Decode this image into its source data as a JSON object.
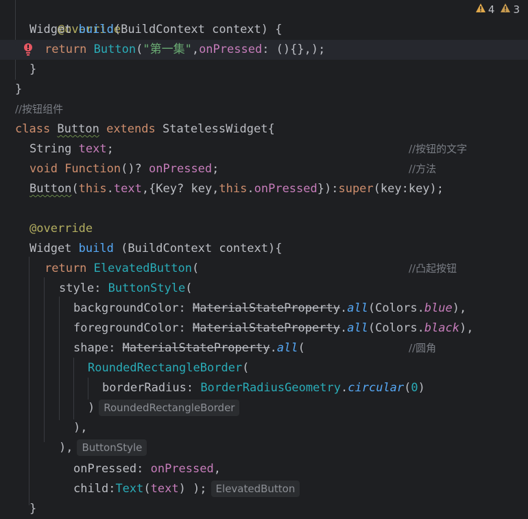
{
  "inspections": {
    "warnings_a": "4",
    "warnings_b": "3",
    "warning_color": "#e0a84b"
  },
  "gutter": {
    "error_icon": "error-bulb-icon"
  },
  "code": {
    "l1": {
      "anno": "@override"
    },
    "l2": {
      "t1": "Widget ",
      "fn": "build",
      "t2": "(BuildContext context) {"
    },
    "l3": {
      "kw": "return ",
      "cls": "Button",
      "p1": "(",
      "str": "\"第一集\"",
      "p2": ",",
      "field": "onPressed",
      "p3": ": (){},);"
    },
    "l4": {
      "t": "}"
    },
    "l5": {
      "t": "}"
    },
    "l6": {
      "cmt": "//按钮组件"
    },
    "l7": {
      "kw1": "class ",
      "cls": "Button",
      "kw2": " extends ",
      "t": "StatelessWidget{"
    },
    "l8": {
      "t": "String ",
      "field": "text",
      "t2": ";",
      "cmt": "//按钮的文字"
    },
    "l9": {
      "kw": "void ",
      "cls": "Function",
      "t": "()? ",
      "field": "onPressed",
      "t2": ";",
      "cmt": "//方法"
    },
    "l10": {
      "cls": "Button",
      "t1": "(",
      "kw1": "this",
      "t2": ".",
      "f1": "text",
      "t3": ",{Key? key,",
      "kw2": "this",
      "t4": ".",
      "f2": "onPressed",
      "t5": "}):",
      "kw3": "super",
      "t6": "(key:key);"
    },
    "l12": {
      "anno": "@override"
    },
    "l13": {
      "t1": "Widget ",
      "fn": "build",
      "t2": " (BuildContext context){"
    },
    "l14": {
      "kw": "return ",
      "cls": "ElevatedButton",
      "t": "(",
      "cmt": "//凸起按钮"
    },
    "l15": {
      "field": "style",
      "t1": ": ",
      "cls": "ButtonStyle",
      "t2": "("
    },
    "l16": {
      "field": "backgroundColor",
      "t1": ": ",
      "dep": "MaterialStateProperty",
      "t2": ".",
      "fn": "all",
      "t3": "(Colors.",
      "it": "blue",
      "t4": "),"
    },
    "l17": {
      "field": "foregroundColor",
      "t1": ": ",
      "dep": "MaterialStateProperty",
      "t2": ".",
      "fn": "all",
      "t3": "(Colors.",
      "it": "black",
      "t4": "),"
    },
    "l18": {
      "field": "shape",
      "t1": ": ",
      "dep": "MaterialStateProperty",
      "t2": ".",
      "fn": "all",
      "t3": "(",
      "cmt": "//圆角"
    },
    "l19": {
      "cls": "RoundedRectangleBorder",
      "t": "("
    },
    "l20": {
      "field": "borderRadius",
      "t1": ": ",
      "cls": "BorderRadiusGeometry",
      "t2": ".",
      "fn": "circular",
      "t3": "(",
      "num": "0",
      "t4": ")"
    },
    "l21": {
      "t": ")",
      "hint": "RoundedRectangleBorder"
    },
    "l22": {
      "t": "),"
    },
    "l23": {
      "t": "),",
      "hint": "ButtonStyle"
    },
    "l24": {
      "field": "onPressed",
      "t1": ": ",
      "f2": "onPressed",
      "t2": ","
    },
    "l25": {
      "field": "child",
      "t1": ":",
      "cls": "Text",
      "t2": "(",
      "f2": "text",
      "t3": ") );",
      "hint": "ElevatedButton"
    },
    "l26": {
      "t": "}"
    }
  }
}
